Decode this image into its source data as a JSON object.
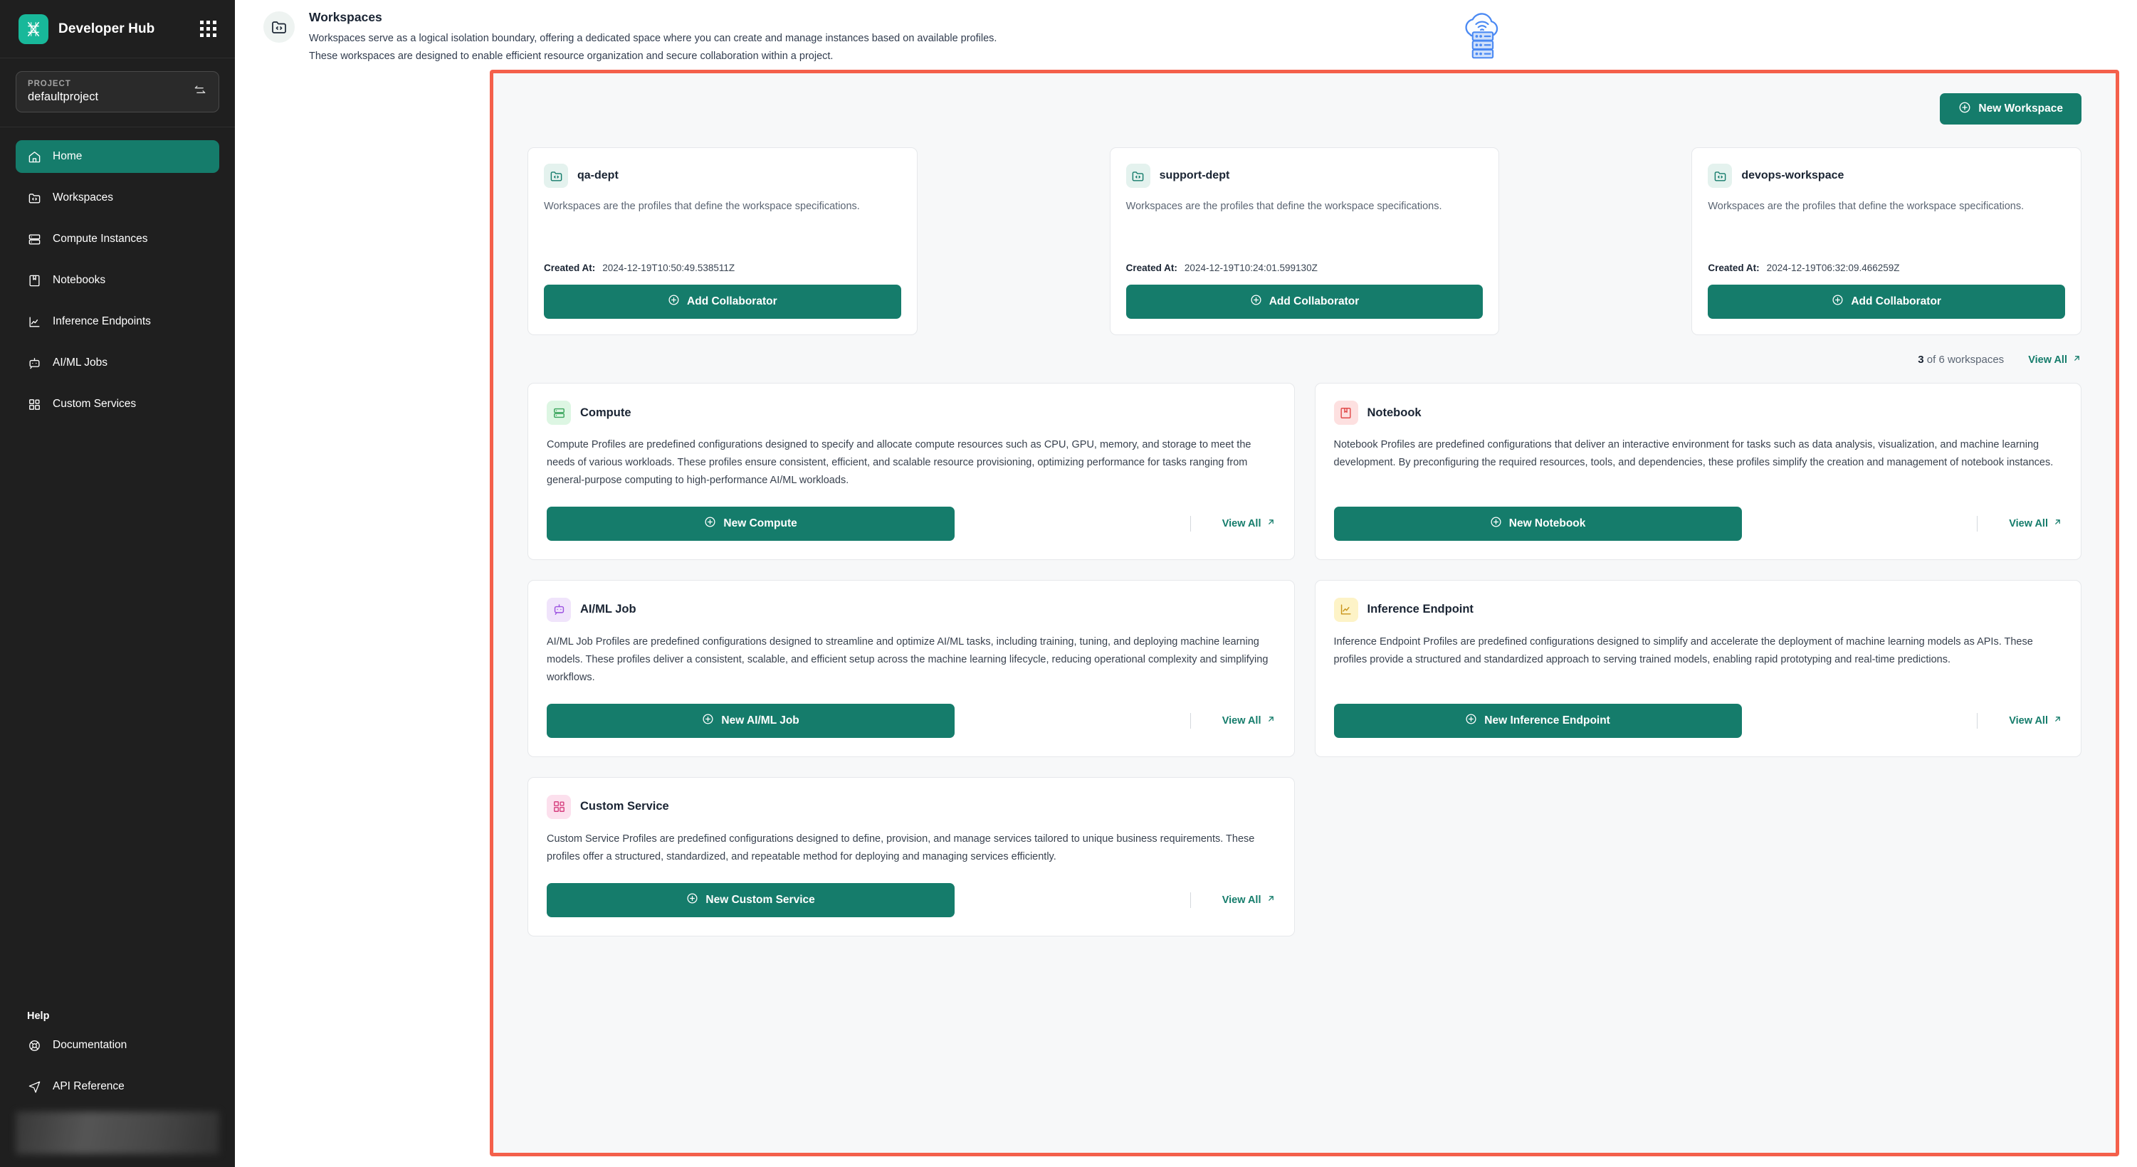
{
  "sidebar": {
    "brand": "Developer Hub",
    "apps_icon": "grid-apps-icon",
    "project": {
      "label": "PROJECT",
      "value": "defaultproject",
      "swap_icon": "swap-arrows-icon"
    },
    "items": [
      {
        "label": "Home",
        "icon": "home-icon",
        "active": true
      },
      {
        "label": "Workspaces",
        "icon": "folder-code-icon",
        "active": false
      },
      {
        "label": "Compute Instances",
        "icon": "server-icon",
        "active": false
      },
      {
        "label": "Notebooks",
        "icon": "book-icon",
        "active": false
      },
      {
        "label": "Inference Endpoints",
        "icon": "chart-line-icon",
        "active": false
      },
      {
        "label": "AI/ML Jobs",
        "icon": "robot-icon",
        "active": false
      },
      {
        "label": "Custom Services",
        "icon": "blocks-icon",
        "active": false
      }
    ],
    "help": {
      "title": "Help",
      "items": [
        {
          "label": "Documentation",
          "icon": "lifebuoy-icon"
        },
        {
          "label": "API Reference",
          "icon": "send-icon"
        }
      ]
    }
  },
  "header": {
    "icon": "folder-code-icon",
    "title": "Workspaces",
    "desc_line1": "Workspaces serve as a logical isolation boundary, offering a dedicated space where you can create and manage instances based on available profiles.",
    "desc_line2": "These workspaces are designed to enable efficient resource organization and secure collaboration within a project.",
    "art_icon": "cloud-server-icon"
  },
  "workspaces_section": {
    "new_button": {
      "label": "New Workspace",
      "icon": "plus-circle-icon"
    },
    "cards": [
      {
        "name": "qa-dept",
        "icon": "folder-code-icon",
        "desc": "Workspaces are the profiles that define the workspace specifications.",
        "created_label": "Created At:",
        "created_value": "2024-12-19T10:50:49.538511Z",
        "action": {
          "label": "Add Collaborator",
          "icon": "plus-circle-icon"
        }
      },
      {
        "name": "support-dept",
        "icon": "folder-code-icon",
        "desc": "Workspaces are the profiles that define the workspace specifications.",
        "created_label": "Created At:",
        "created_value": "2024-12-19T10:24:01.599130Z",
        "action": {
          "label": "Add Collaborator",
          "icon": "plus-circle-icon"
        }
      },
      {
        "name": "devops-workspace",
        "icon": "folder-code-icon",
        "desc": "Workspaces are the profiles that define the workspace specifications.",
        "created_label": "Created At:",
        "created_value": "2024-12-19T06:32:09.466259Z",
        "action": {
          "label": "Add Collaborator",
          "icon": "plus-circle-icon"
        }
      }
    ],
    "count_prefix": "3",
    "count_suffix": " of 6 workspaces",
    "view_all": "View All"
  },
  "profiles": [
    {
      "title": "Compute",
      "icon": "server-icon",
      "icon_color": "green",
      "desc": "Compute Profiles are predefined configurations designed to specify and allocate compute resources such as CPU, GPU, memory, and storage to meet the needs of various workloads. These profiles ensure consistent, efficient, and scalable resource provisioning, optimizing performance for tasks ranging from general-purpose computing to high-performance AI/ML workloads.",
      "button": {
        "label": "New Compute",
        "icon": "plus-circle-icon"
      },
      "view_all": "View All"
    },
    {
      "title": "Notebook",
      "icon": "book-icon",
      "icon_color": "red",
      "desc": "Notebook Profiles are predefined configurations that deliver an interactive environment for tasks such as data analysis, visualization, and machine learning development. By preconfiguring the required resources, tools, and dependencies, these profiles simplify the creation and management of notebook instances.",
      "button": {
        "label": "New Notebook",
        "icon": "plus-circle-icon"
      },
      "view_all": "View All"
    },
    {
      "title": "AI/ML Job",
      "icon": "robot-icon",
      "icon_color": "purple",
      "desc": "AI/ML Job Profiles are predefined configurations designed to streamline and optimize AI/ML tasks, including training, tuning, and deploying machine learning models. These profiles deliver a consistent, scalable, and efficient setup across the machine learning lifecycle, reducing operational complexity and simplifying workflows.",
      "button": {
        "label": "New AI/ML Job",
        "icon": "plus-circle-icon"
      },
      "view_all": "View All"
    },
    {
      "title": "Inference Endpoint",
      "icon": "chart-line-icon",
      "icon_color": "yellow",
      "desc": "Inference Endpoint Profiles are predefined configurations designed to simplify and accelerate the deployment of machine learning models as APIs. These profiles provide a structured and standardized approach to serving trained models, enabling rapid prototyping and real-time predictions.",
      "button": {
        "label": "New Inference Endpoint",
        "icon": "plus-circle-icon"
      },
      "view_all": "View All"
    },
    {
      "title": "Custom Service",
      "icon": "blocks-icon",
      "icon_color": "pink",
      "desc": "Custom Service Profiles are predefined configurations designed to define, provision, and manage services tailored to unique business requirements. These profiles offer a structured, standardized, and repeatable method for deploying and managing services efficiently.",
      "button": {
        "label": "New Custom Service",
        "icon": "plus-circle-icon"
      },
      "view_all": "View All"
    }
  ],
  "colors": {
    "brand_teal": "#157c6b",
    "logo_teal": "#18b89a",
    "highlight_red": "#f4604b",
    "sidebar_bg": "#1f1f1f"
  }
}
